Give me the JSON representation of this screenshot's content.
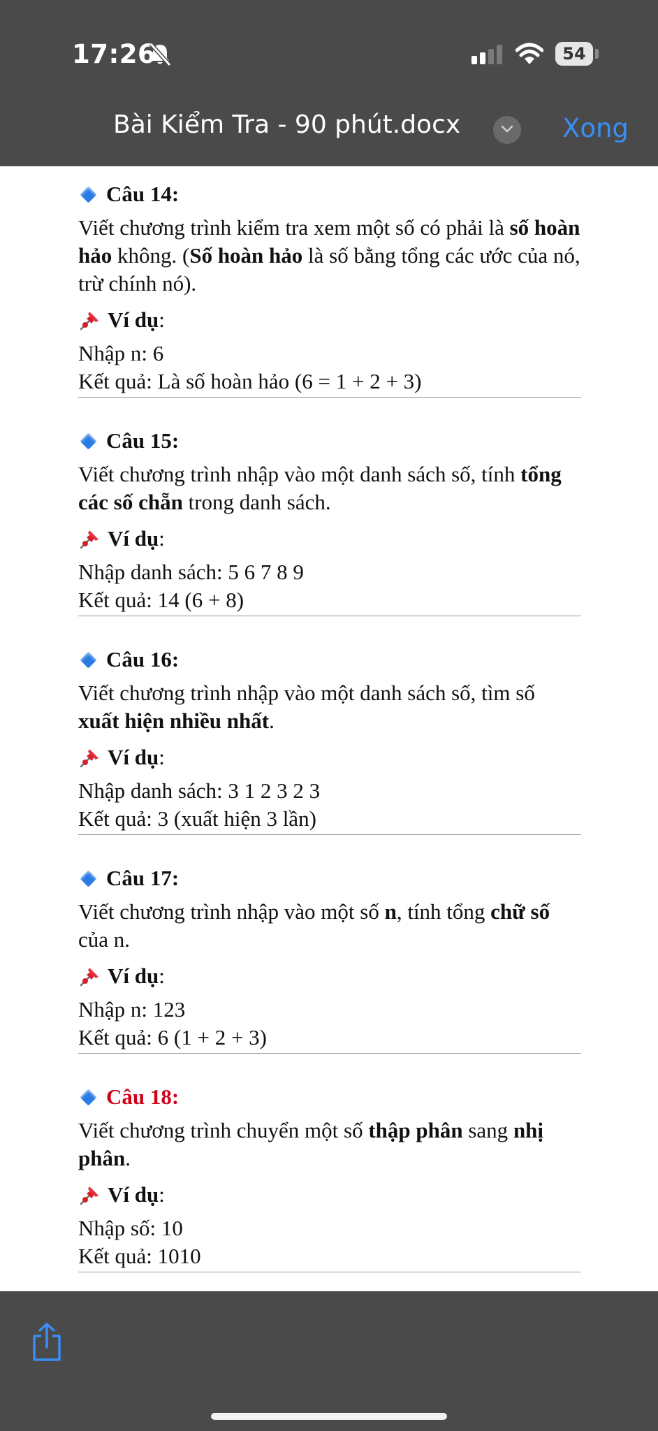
{
  "status_bar": {
    "time": "17:26",
    "battery_level": "54"
  },
  "nav": {
    "document_title": "Bài Kiểm Tra - 90 phút.docx",
    "done_label": "Xong"
  },
  "colors": {
    "accent": "#3a8ef5",
    "bar_background": "#4a4a4a",
    "question_18_heading": "#d0021b",
    "diamond": "#2a7be4"
  },
  "questions": [
    {
      "heading": "Câu 14:",
      "body_parts": [
        {
          "text": "Viết chương trình kiểm tra xem một số có phải là ",
          "bold": false
        },
        {
          "text": "số hoàn hảo",
          "bold": true
        },
        {
          "text": " không. (",
          "bold": false
        },
        {
          "text": "Số hoàn hảo",
          "bold": true
        },
        {
          "text": " là số bằng tổng các ước của nó, trừ chính nó).",
          "bold": false
        }
      ],
      "example_label": "Ví dụ",
      "example_lines": [
        "Nhập n: 6",
        "Kết quả: Là số hoàn hảo (6 = 1 + 2 + 3)"
      ]
    },
    {
      "heading": "Câu 15:",
      "body_parts": [
        {
          "text": "Viết chương trình nhập vào một danh sách số, tính ",
          "bold": false
        },
        {
          "text": "tổng các số chẵn",
          "bold": true
        },
        {
          "text": " trong danh sách.",
          "bold": false
        }
      ],
      "example_label": "Ví dụ",
      "example_lines": [
        "Nhập danh sách: 5 6 7 8 9",
        "Kết quả: 14  (6 + 8)"
      ]
    },
    {
      "heading": "Câu 16:",
      "body_parts": [
        {
          "text": "Viết chương trình nhập vào một danh sách số, tìm số ",
          "bold": false
        },
        {
          "text": "xuất hiện nhiều nhất",
          "bold": true
        },
        {
          "text": ".",
          "bold": false
        }
      ],
      "example_label": "Ví dụ",
      "example_lines": [
        "Nhập danh sách: 3 1 2 3 2 3",
        "Kết quả: 3 (xuất hiện 3 lần)"
      ]
    },
    {
      "heading": "Câu 17:",
      "body_parts": [
        {
          "text": "Viết chương trình nhập vào một số ",
          "bold": false
        },
        {
          "text": "n",
          "bold": true
        },
        {
          "text": ", tính tổng ",
          "bold": false
        },
        {
          "text": "chữ số",
          "bold": true
        },
        {
          "text": " của n.",
          "bold": false
        }
      ],
      "example_label": "Ví dụ",
      "example_lines": [
        "Nhập n: 123",
        "Kết quả: 6 (1 + 2 + 3)"
      ]
    },
    {
      "heading": "Câu 18:",
      "heading_red": true,
      "body_parts": [
        {
          "text": "Viết chương trình chuyển một số ",
          "bold": false
        },
        {
          "text": "thập phân",
          "bold": true
        },
        {
          "text": " sang ",
          "bold": false
        },
        {
          "text": "nhị phân",
          "bold": true
        },
        {
          "text": ".",
          "bold": false
        }
      ],
      "example_label": "Ví dụ",
      "example_lines": [
        "Nhập số: 10",
        "Kết quả: 1010"
      ]
    }
  ]
}
